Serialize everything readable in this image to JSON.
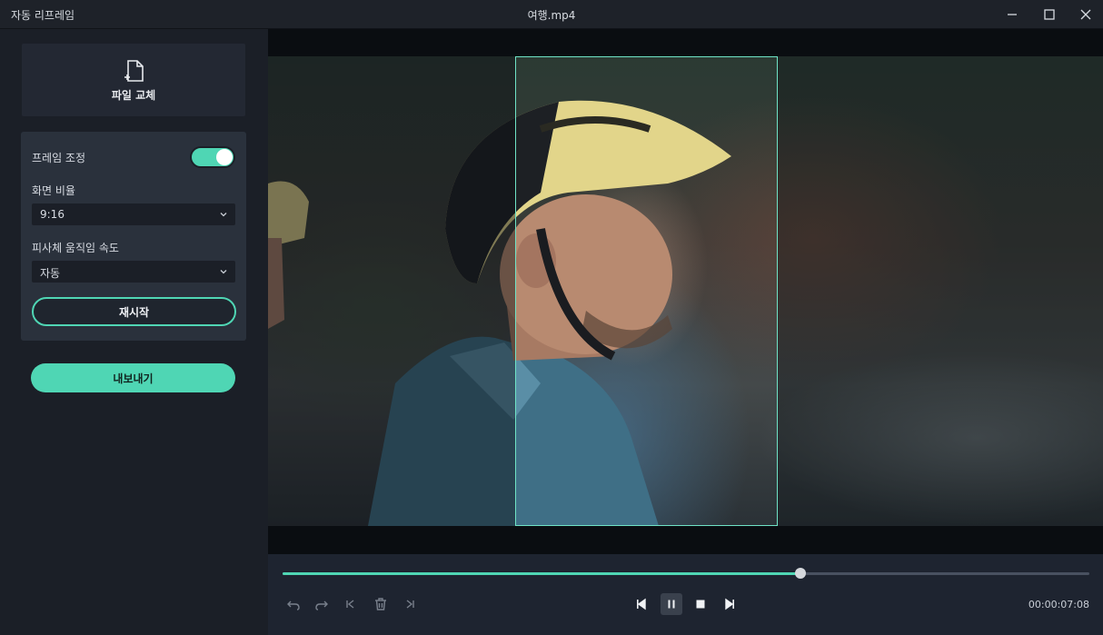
{
  "window": {
    "app_title": "자동 리프레임",
    "file_title": "여행.mp4",
    "controls": [
      "minimize-icon",
      "maximize-icon",
      "close-icon"
    ]
  },
  "sidebar": {
    "replace_file_label": "파일 교체",
    "frame_adjust": {
      "label": "프레임 조정",
      "enabled": true
    },
    "aspect_ratio": {
      "label": "화면 비율",
      "value": "9:16"
    },
    "motion_speed": {
      "label": "피사체 움직임 속도",
      "value": "자동"
    },
    "restart_label": "재시작",
    "export_label": "내보내기"
  },
  "player": {
    "progress_fraction": 0.642,
    "timecode": "00:00:07:08",
    "edit_tools": [
      "undo-icon",
      "redo-icon",
      "jump-start-icon",
      "delete-icon",
      "jump-end-icon"
    ],
    "playback": [
      "step-back-icon",
      "pause-icon",
      "stop-icon",
      "step-forward-icon"
    ]
  },
  "colors": {
    "accent": "#4fd6b4",
    "crop_frame": "#6fe3c6",
    "panel_bg": "#2a313c",
    "app_bg": "#1b1f27"
  }
}
